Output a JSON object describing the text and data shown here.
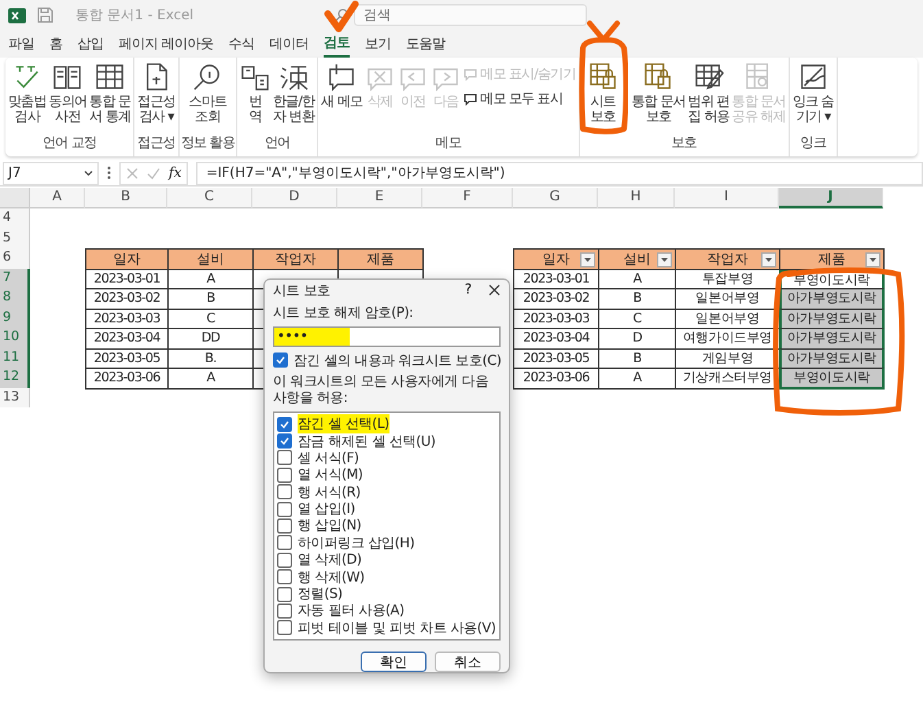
{
  "title_bar": {
    "document_title": "통합 문서1 - Excel",
    "search": {
      "placeholder": "검색"
    }
  },
  "menu_tabs": [
    {
      "label": "파일",
      "selected": false
    },
    {
      "label": "홈",
      "selected": false
    },
    {
      "label": "삽입",
      "selected": false
    },
    {
      "label": "페이지 레이아웃",
      "selected": false
    },
    {
      "label": "수식",
      "selected": false
    },
    {
      "label": "데이터",
      "selected": false
    },
    {
      "label": "검토",
      "selected": true
    },
    {
      "label": "보기",
      "selected": false
    },
    {
      "label": "도움말",
      "selected": false
    }
  ],
  "ribbon": {
    "groups": [
      {
        "label": "언어 교정",
        "buttons": [
          {
            "lines": [
              "맞춤법",
              "검사"
            ],
            "disabled": false
          },
          {
            "lines": [
              "동의어",
              "사전"
            ],
            "disabled": false
          },
          {
            "lines": [
              "통합 문",
              "서 통계"
            ],
            "disabled": false
          }
        ]
      },
      {
        "label": "접근성",
        "buttons": [
          {
            "lines": [
              "접근성",
              "검사 ▾"
            ],
            "disabled": false
          }
        ]
      },
      {
        "label": "정보 활용",
        "buttons": [
          {
            "lines": [
              "스마트",
              "조회"
            ],
            "disabled": false
          }
        ]
      },
      {
        "label": "언어",
        "buttons": [
          {
            "lines": [
              "번",
              "역"
            ],
            "disabled": false
          },
          {
            "lines": [
              "한글/한",
              "자 변환"
            ],
            "disabled": false
          }
        ]
      },
      {
        "label": "메모",
        "buttons": [
          {
            "lines": [
              "새 메모"
            ],
            "disabled": false
          },
          {
            "lines": [
              "삭제"
            ],
            "disabled": true
          },
          {
            "lines": [
              "이전"
            ],
            "disabled": true
          },
          {
            "lines": [
              "다음"
            ],
            "disabled": true
          }
        ],
        "small_buttons": [
          {
            "label": "메모 표시/숨기기",
            "disabled": true
          },
          {
            "label": "메모 모두 표시",
            "disabled": false
          }
        ]
      },
      {
        "label": "보호",
        "buttons": [
          {
            "lines": [
              "시트",
              "보호"
            ],
            "disabled": false
          },
          {
            "lines": [
              "통합 문서",
              "보호"
            ],
            "disabled": false
          },
          {
            "lines": [
              "범위 편",
              "집 허용"
            ],
            "disabled": false
          },
          {
            "lines": [
              "통합 문서",
              "공유 해제"
            ],
            "disabled": true
          }
        ]
      },
      {
        "label": "잉크",
        "buttons": [
          {
            "lines": [
              "잉크 숨",
              "기기 ▾"
            ],
            "disabled": false
          }
        ]
      }
    ]
  },
  "formula_bar": {
    "name_box": "J7",
    "fx": "fx",
    "formula": "=IF(H7=\"A\",\"부영이도시락\",\"아가부영도시락\")"
  },
  "sheet": {
    "columns": [
      {
        "label": "A",
        "selected": false
      },
      {
        "label": "B",
        "selected": false
      },
      {
        "label": "C",
        "selected": false
      },
      {
        "label": "D",
        "selected": false
      },
      {
        "label": "E",
        "selected": false
      },
      {
        "label": "F",
        "selected": false
      },
      {
        "label": "G",
        "selected": false
      },
      {
        "label": "H",
        "selected": false
      },
      {
        "label": "I",
        "selected": false
      },
      {
        "label": "J",
        "selected": true
      }
    ],
    "row_numbers": [
      {
        "label": "4",
        "selected": false
      },
      {
        "label": "5",
        "selected": false
      },
      {
        "label": "6",
        "selected": false
      },
      {
        "label": "7",
        "selected": true
      },
      {
        "label": "8",
        "selected": true
      },
      {
        "label": "9",
        "selected": true
      },
      {
        "label": "10",
        "selected": true
      },
      {
        "label": "11",
        "selected": true
      },
      {
        "label": "12",
        "selected": true
      },
      {
        "label": "13",
        "selected": false
      }
    ],
    "tables": [
      {
        "columns": [
          {
            "label": "일자",
            "filter": false
          },
          {
            "label": "설비",
            "filter": false
          },
          {
            "label": "작업자",
            "filter": false
          },
          {
            "label": "제품",
            "filter": false
          }
        ],
        "rows": [
          {
            "cells": [
              "2023-03-01",
              "A"
            ]
          },
          {
            "cells": [
              "2023-03-02",
              "B"
            ]
          },
          {
            "cells": [
              "2023-03-03",
              "C"
            ]
          },
          {
            "cells": [
              "2023-03-04",
              "DD"
            ]
          },
          {
            "cells": [
              "2023-03-05",
              "B."
            ]
          },
          {
            "cells": [
              "2023-03-06",
              "A"
            ]
          }
        ]
      },
      {
        "columns": [
          {
            "label": "일자",
            "filter": true
          },
          {
            "label": "설비",
            "filter": true
          },
          {
            "label": "작업자",
            "filter": true
          },
          {
            "label": "제품",
            "filter": true
          }
        ],
        "rows": [
          {
            "cells": [
              "2023-03-01",
              "A",
              "투잡부영",
              "부영이도시락"
            ],
            "selected": true,
            "active": true
          },
          {
            "cells": [
              "2023-03-02",
              "B",
              "일본어부영",
              "아가부영도시락"
            ],
            "selected": true,
            "active": false
          },
          {
            "cells": [
              "2023-03-03",
              "C",
              "일본어부영",
              "아가부영도시락"
            ],
            "selected": true,
            "active": false
          },
          {
            "cells": [
              "2023-03-04",
              "D",
              "여행가이드부영",
              "아가부영도시락"
            ],
            "selected": true,
            "active": false
          },
          {
            "cells": [
              "2023-03-05",
              "B",
              "게임부영",
              "아가부영도시락"
            ],
            "selected": true,
            "active": false
          },
          {
            "cells": [
              "2023-03-06",
              "A",
              "기상캐스터부영",
              "부영이도시락"
            ],
            "selected": true,
            "active": false
          }
        ]
      }
    ]
  },
  "dialog": {
    "title": "시트 보호",
    "help": "?",
    "password_label": "시트 보호 해제 암호(P):",
    "password": {
      "value": "••••",
      "highlighted": true
    },
    "protect_option": {
      "label": "잠긴 셀의 내용과 워크시트 보호(C)",
      "checked": true
    },
    "allow_label": "이 워크시트의 모든 사용자에게 다음 사항을 허용:",
    "permissions": [
      {
        "label": "잠긴 셀 선택(L)",
        "checked": true,
        "highlighted": true
      },
      {
        "label": "잠금 해제된 셀 선택(U)",
        "checked": true,
        "highlighted": false
      },
      {
        "label": "셀 서식(F)",
        "checked": false,
        "highlighted": false
      },
      {
        "label": "열 서식(M)",
        "checked": false,
        "highlighted": false
      },
      {
        "label": "행 서식(R)",
        "checked": false,
        "highlighted": false
      },
      {
        "label": "열 삽입(I)",
        "checked": false,
        "highlighted": false
      },
      {
        "label": "행 삽입(N)",
        "checked": false,
        "highlighted": false
      },
      {
        "label": "하이퍼링크 삽입(H)",
        "checked": false,
        "highlighted": false
      },
      {
        "label": "열 삭제(D)",
        "checked": false,
        "highlighted": false
      },
      {
        "label": "행 삭제(W)",
        "checked": false,
        "highlighted": false
      },
      {
        "label": "정렬(S)",
        "checked": false,
        "highlighted": false
      },
      {
        "label": "자동 필터 사용(A)",
        "checked": false,
        "highlighted": false
      },
      {
        "label": "피벗 테이블 및 피벗 차트 사용(V)",
        "checked": false,
        "highlighted": false
      }
    ],
    "buttons": [
      {
        "label": "확인",
        "selected": true
      },
      {
        "label": "취소",
        "selected": false
      }
    ]
  }
}
